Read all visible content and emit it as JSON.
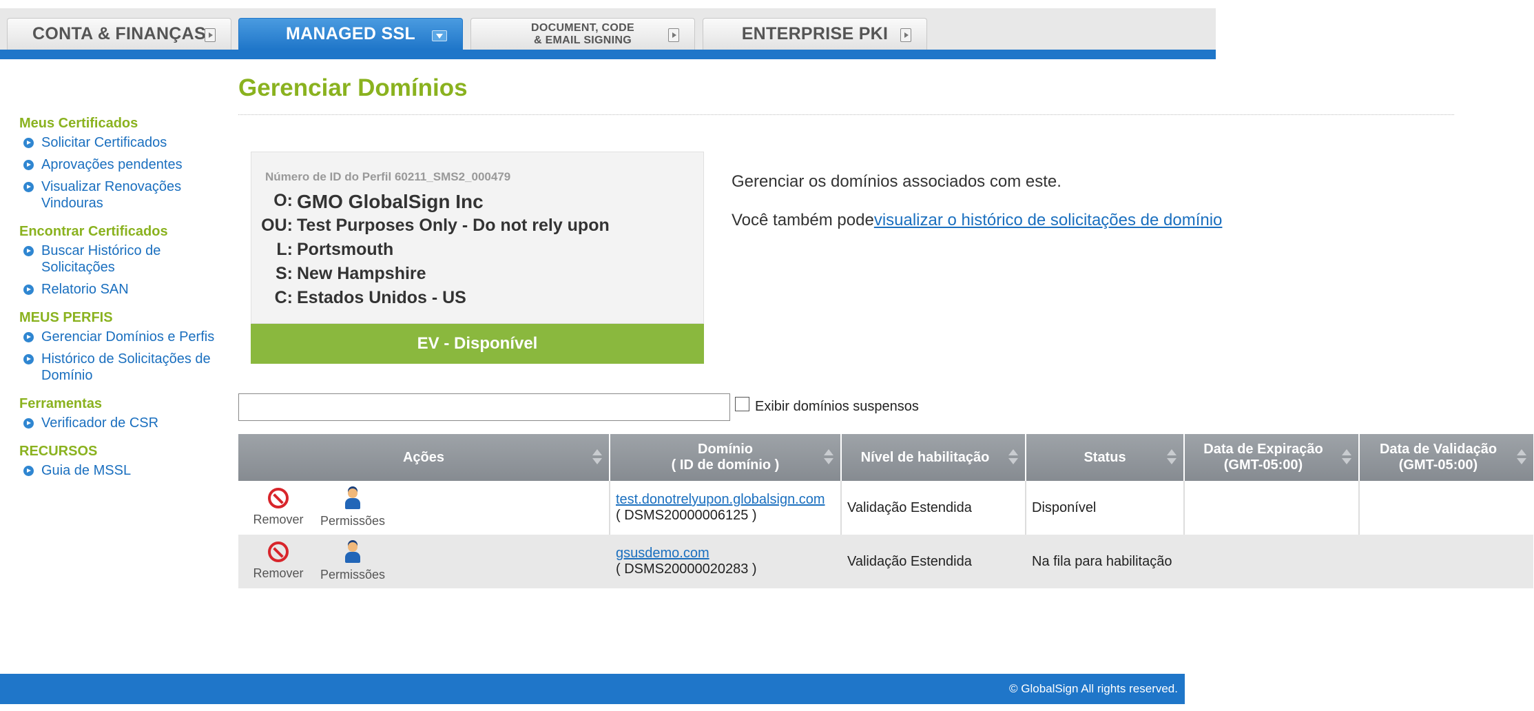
{
  "nav": {
    "tabs": [
      {
        "label": "CONTA & FINANÇAS"
      },
      {
        "label": "MANAGED SSL"
      },
      {
        "label_line1": "DOCUMENT, CODE",
        "label_line2": "& EMAIL SIGNING"
      },
      {
        "label": "ENTERPRISE PKI"
      }
    ]
  },
  "sidebar": {
    "sections": [
      {
        "title": "Meus Certificados",
        "items": [
          "Solicitar Certificados",
          "Aprovações pendentes",
          "Visualizar Renovações Vindouras"
        ]
      },
      {
        "title": "Encontrar Certificados",
        "items": [
          "Buscar Histórico de Solicitações",
          "Relatorio SAN"
        ]
      },
      {
        "title": "MEUS PERFIS",
        "items": [
          "Gerenciar Domínios e Perfis",
          "Histórico de Solicitações de Domínio"
        ]
      },
      {
        "title": "Ferramentas",
        "items": [
          "Verificador de CSR"
        ]
      },
      {
        "title": "RECURSOS",
        "items": [
          "Guia de MSSL"
        ]
      }
    ]
  },
  "main": {
    "title": "Gerenciar Domínios",
    "profile": {
      "id_label": "Número de ID do Perfil 60211_SMS2_000479",
      "rows": [
        {
          "k": "O:",
          "v": "GMO GlobalSign Inc"
        },
        {
          "k": "OU:",
          "v": "Test Purposes Only - Do not rely upon"
        },
        {
          "k": "L:",
          "v": "Portsmouth"
        },
        {
          "k": "S:",
          "v": "New Hampshire"
        },
        {
          "k": "C:",
          "v": "Estados Unidos - US"
        }
      ],
      "ev_status": "EV - Disponível"
    },
    "desc1": "Gerenciar os domínios associados com este.",
    "desc2_prefix": "Você também pode",
    "desc2_link": "visualizar o histórico de solicitações de domínio",
    "filter": {
      "value": "",
      "checkbox_label": "Exibir domínios suspensos"
    },
    "table": {
      "headers": {
        "acoes": "Ações",
        "dominio_line1": "Domínio",
        "dominio_line2": "( ID de domínio )",
        "nivel": "Nível de habilitação",
        "status": "Status",
        "expiracao_line1": "Data de Expiração",
        "expiracao_line2": "(GMT-05:00)",
        "validacao_line1": "Data de Validação",
        "validacao_line2": "(GMT-05:00)"
      },
      "action_labels": {
        "remove": "Remover",
        "permissions": "Permissões"
      },
      "rows": [
        {
          "domain": "test.donotrelyupon.globalsign.com",
          "domain_id": "( DSMS20000006125 )",
          "nivel": "Validação Estendida",
          "status": "Disponível",
          "expiracao": "",
          "validacao": ""
        },
        {
          "domain": "gsusdemo.com",
          "domain_id": "( DSMS20000020283 )",
          "nivel": "Validação Estendida",
          "status": "Na fila para habilitação",
          "expiracao": "",
          "validacao": ""
        }
      ]
    }
  },
  "footer": {
    "copyright": "© GlobalSign All rights reserved."
  }
}
